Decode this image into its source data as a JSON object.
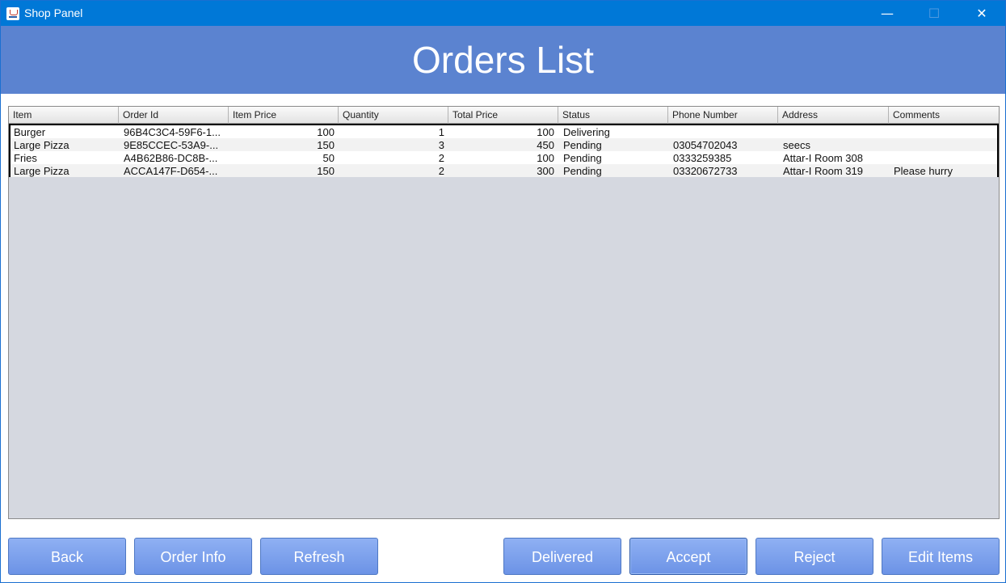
{
  "window": {
    "title": "Shop Panel",
    "minimize_glyph": "—",
    "maximize_glyph": "☐",
    "close_glyph": "✕"
  },
  "header": {
    "title": "Orders List",
    "background": "#5b83d0"
  },
  "table": {
    "columns": [
      "Item",
      "Order Id",
      "Item Price",
      "Quantity",
      "Total Price",
      "Status",
      "Phone Number",
      "Address",
      "Comments"
    ],
    "rows": [
      {
        "item": "Burger",
        "order_id": "96B4C3C4-59F6-1...",
        "item_price": "100",
        "quantity": "1",
        "total_price": "100",
        "status": "Delivering",
        "phone": "",
        "address": "",
        "comments": ""
      },
      {
        "item": "Large Pizza",
        "order_id": "9E85CCEC-53A9-...",
        "item_price": "150",
        "quantity": "3",
        "total_price": "450",
        "status": "Pending",
        "phone": "03054702043",
        "address": "seecs",
        "comments": ""
      },
      {
        "item": "Fries",
        "order_id": "A4B62B86-DC8B-...",
        "item_price": "50",
        "quantity": "2",
        "total_price": "100",
        "status": "Pending",
        "phone": "0333259385",
        "address": "Attar-I Room 308",
        "comments": ""
      },
      {
        "item": "Large Pizza",
        "order_id": "ACCA147F-D654-...",
        "item_price": "150",
        "quantity": "2",
        "total_price": "300",
        "status": "Pending",
        "phone": "03320672733",
        "address": "Attar-I Room 319",
        "comments": "Please hurry"
      }
    ]
  },
  "buttons": {
    "back": "Back",
    "order_info": "Order Info",
    "refresh": "Refresh",
    "delivered": "Delivered",
    "accept": "Accept",
    "reject": "Reject",
    "edit_items": "Edit Items"
  },
  "colors": {
    "titlebar": "#0078d7",
    "button": "#7a9ded",
    "table_bg": "#d5d8e0"
  }
}
